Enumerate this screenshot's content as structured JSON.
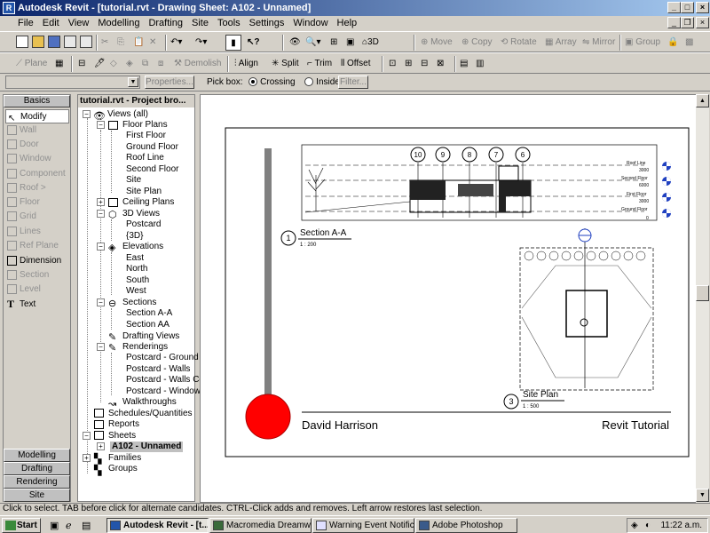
{
  "window": {
    "title": "Autodesk Revit - [tutorial.rvt - Drawing Sheet: A102 - Unnamed]",
    "min": "_",
    "max": "□",
    "close": "×"
  },
  "menu": [
    "File",
    "Edit",
    "View",
    "Modelling",
    "Drafting",
    "Site",
    "Tools",
    "Settings",
    "Window",
    "Help"
  ],
  "toolbar1": {
    "view_3d": "3D",
    "move": "Move",
    "copy": "Copy",
    "rotate": "Rotate",
    "array": "Array",
    "mirror": "Mirror",
    "group": "Group"
  },
  "toolbar2": {
    "plane": "Plane",
    "demolish": "Demolish",
    "align": "Align",
    "split": "Split",
    "trim": "Trim",
    "offset": "Offset"
  },
  "options": {
    "properties": "Properties...",
    "pick_box": "Pick box:",
    "crossing": "Crossing",
    "inside": "Inside",
    "filter": "Filter..."
  },
  "design_bar": {
    "active_tab": "Basics",
    "tools": [
      "Modify",
      "Wall",
      "Door",
      "Window",
      "Component",
      "Roof",
      "Floor",
      "Grid",
      "Lines",
      "Ref Plane",
      "Dimension",
      "Section",
      "Level",
      "Text"
    ],
    "tabs": [
      "Modelling",
      "Drafting",
      "Rendering",
      "Site"
    ]
  },
  "browser": {
    "title": "tutorial.rvt - Project bro...",
    "nodes": [
      "Views (all)",
      "Floor Plans",
      "First Floor",
      "Ground Floor",
      "Roof Line",
      "Second Floor",
      "Site",
      "Site Plan",
      "Ceiling Plans",
      "3D Views",
      "Postcard",
      "{3D}",
      "Elevations",
      "East",
      "North",
      "South",
      "West",
      "Sections",
      "Section A-A",
      "Section AA",
      "Drafting Views",
      "Renderings",
      "Postcard - Ground",
      "Postcard - Walls",
      "Postcard - Walls Cor",
      "Postcard - Windows",
      "Walkthroughs",
      "Schedules/Quantities",
      "Reports",
      "Sheets",
      "A102 - Unnamed",
      "Families",
      "Groups"
    ]
  },
  "sheet": {
    "view1_num": "1",
    "view1_name": "Section A-A",
    "view1_scale": "1 : 200",
    "view3_num": "3",
    "view3_name": "Site Plan",
    "view3_scale": "1 : 500",
    "author": "David Harrison",
    "project": "Revit Tutorial",
    "grids": [
      "10",
      "9",
      "8",
      "7",
      "6"
    ],
    "levels": [
      "Roof Line",
      "Second Floor",
      "First Floor",
      "Ground Floor"
    ],
    "level_values": [
      "3000",
      "6000",
      "3000",
      "0"
    ]
  },
  "status": "Click to select. TAB before click for alternate candidates. CTRL-Click adds and removes. Left arrow restores last selection.",
  "taskbar": {
    "start": "Start",
    "items": [
      "Autodesk Revit - [t...",
      "Macromedia Dreamwe...",
      "Warning Event Notific...",
      "Adobe Photoshop"
    ],
    "time": "11:22 a.m."
  }
}
